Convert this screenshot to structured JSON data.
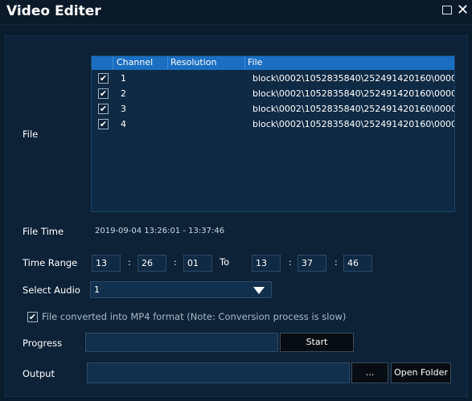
{
  "window": {
    "title": "Video Editer"
  },
  "labels": {
    "file": "File",
    "file_time": "File Time",
    "time_range": "Time Range",
    "select_audio": "Select Audio",
    "progress": "Progress",
    "output": "Output",
    "to": "To"
  },
  "table": {
    "headers": {
      "channel": "Channel",
      "resolution": "Resolution",
      "file": "File"
    },
    "rows": [
      {
        "checked": true,
        "channel": "1",
        "resolution": "",
        "file": "block\\0002\\1052835840\\252491420160\\0000"
      },
      {
        "checked": true,
        "channel": "2",
        "resolution": "",
        "file": "block\\0002\\1052835840\\252491420160\\0000"
      },
      {
        "checked": true,
        "channel": "3",
        "resolution": "",
        "file": "block\\0002\\1052835840\\252491420160\\0000"
      },
      {
        "checked": true,
        "channel": "4",
        "resolution": "",
        "file": "block\\0002\\1052835840\\252491420160\\0000"
      }
    ]
  },
  "file_time": "2019-09-04 13:26:01 - 13:37:46",
  "time_range": {
    "start": {
      "h": "13",
      "m": "26",
      "s": "01"
    },
    "end": {
      "h": "13",
      "m": "37",
      "s": "46"
    }
  },
  "audio": {
    "selected": "1"
  },
  "mp4": {
    "checked": true,
    "label": "File converted into MP4 format (Note: Conversion process is slow)"
  },
  "buttons": {
    "start": "Start",
    "browse": "...",
    "open_folder": "Open Folder"
  },
  "icons": {
    "check": "✔",
    "close": "✕"
  },
  "colors": {
    "background": "#0b1c2d",
    "header": "#1b6fc3",
    "button": "#070d12"
  }
}
